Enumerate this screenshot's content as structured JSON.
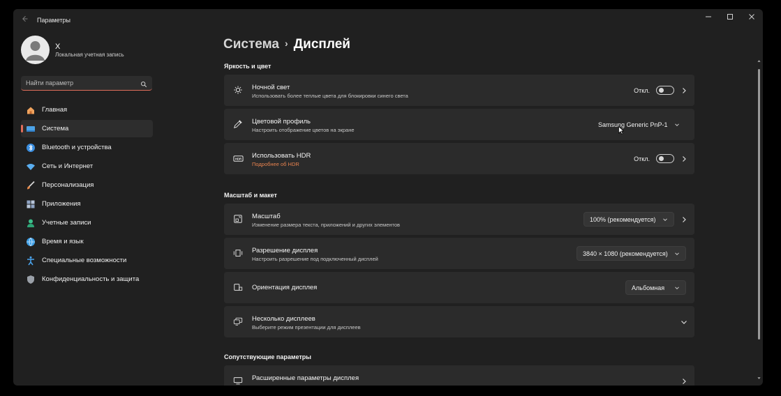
{
  "window": {
    "title": "Параметры",
    "controls": [
      "minimize-icon",
      "maximize-icon",
      "close-icon"
    ]
  },
  "user": {
    "name": "X",
    "account_type": "Локальная учетная запись"
  },
  "search": {
    "placeholder": "Найти параметр"
  },
  "sidebar": {
    "items": [
      {
        "label": "Главная",
        "icon": "home-icon",
        "color": "#f0a35e"
      },
      {
        "label": "Система",
        "icon": "system-icon",
        "color": "#4ca3e8",
        "active": true
      },
      {
        "label": "Bluetooth и устройства",
        "icon": "bluetooth-icon",
        "color": "#3b8ee0"
      },
      {
        "label": "Сеть и Интернет",
        "icon": "wifi-icon",
        "color": "#5aaef0"
      },
      {
        "label": "Персонализация",
        "icon": "brush-icon",
        "color": "#e88a4a"
      },
      {
        "label": "Приложения",
        "icon": "apps-icon",
        "color": "#8fa4c4"
      },
      {
        "label": "Учетные записи",
        "icon": "accounts-icon",
        "color": "#3cc08c"
      },
      {
        "label": "Время и язык",
        "icon": "time-language-icon",
        "color": "#3b9ee6"
      },
      {
        "label": "Специальные возможности",
        "icon": "accessibility-icon",
        "color": "#4aa6f0"
      },
      {
        "label": "Конфиденциальность и защита",
        "icon": "shield-icon",
        "color": "#9aa0a8"
      }
    ]
  },
  "breadcrumb": {
    "parent": "Система",
    "current": "Дисплей"
  },
  "sections": {
    "brightness": "Яркость и цвет",
    "scale": "Масштаб и макет",
    "related": "Сопутствующие параметры"
  },
  "night_light": {
    "title": "Ночной свет",
    "subtitle": "Использовать более теплые цвета для блокировки синего света",
    "state": "Откл."
  },
  "color_profile": {
    "title": "Цветовой профиль",
    "subtitle": "Настроить отображение цветов на экране",
    "value": "Samsung Generic PnP-1"
  },
  "hdr": {
    "title": "Использовать HDR",
    "link": "Подробнее об HDR",
    "state": "Откл."
  },
  "scale": {
    "title": "Масштаб",
    "subtitle": "Изменение размера текста, приложений и других элементов",
    "value": "100% (рекомендуется)"
  },
  "resolution": {
    "title": "Разрешение дисплея",
    "subtitle": "Настроить разрешение под подключенный дисплей",
    "value": "3840 × 1080 (рекомендуется)"
  },
  "orientation": {
    "title": "Ориентация дисплея",
    "value": "Альбомная"
  },
  "multiple_displays": {
    "title": "Несколько дисплеев",
    "subtitle": "Выберите режим презентации для дисплеев"
  },
  "advanced": {
    "title": "Расширенные параметры дисплея"
  },
  "colors": {
    "accent": "#e06d5a",
    "link": "#e8834f"
  }
}
